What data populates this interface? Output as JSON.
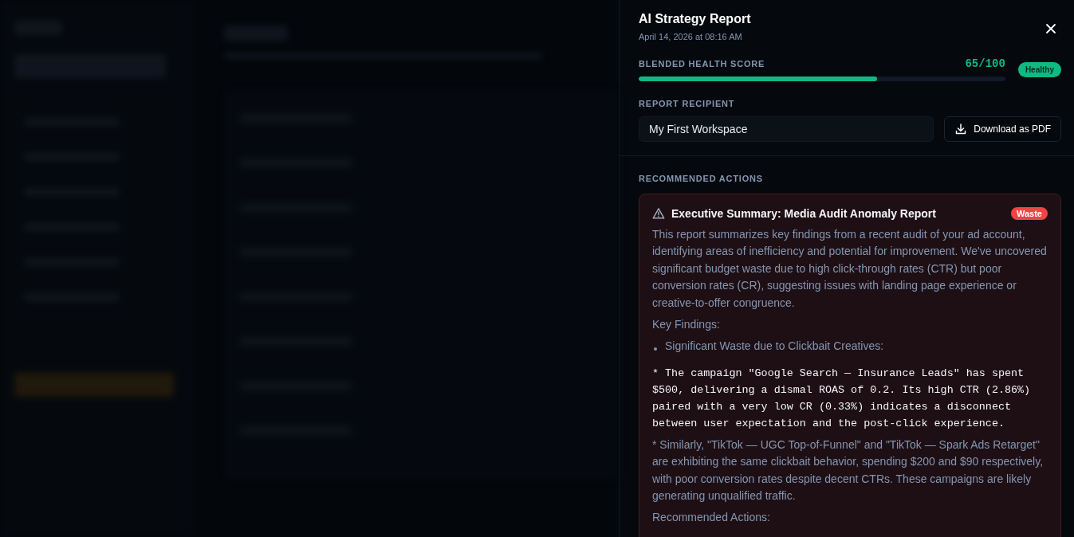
{
  "drawer": {
    "title": "AI Strategy Report",
    "date": "April 14, 2026 at 08:16 AM",
    "health": {
      "label": "BLENDED HEALTH SCORE",
      "score": "65/100",
      "level": 0.65,
      "status": "Healthy"
    },
    "recipient": {
      "label": "REPORT RECIPIENT",
      "value": "My First Workspace"
    },
    "download_button": "Download as PDF",
    "actions": {
      "label": "RECOMMENDED ACTIONS",
      "items": [
        {
          "title": "Executive Summary: Media Audit Anomaly Report",
          "tag": "Waste",
          "color": "#ef4444",
          "blocks": [
            {
              "kind": "paragraph",
              "text": "This report summarizes key findings from a recent audit of your ad account, identifying areas of inefficiency and potential for improvement. We've uncovered significant budget waste due to high click-through rates (CTR) but poor conversion rates (CR), suggesting issues with landing page experience or creative-to-offer congruence."
            },
            {
              "kind": "paragraph",
              "text": "Key Findings:"
            },
            {
              "kind": "bullet",
              "text": "Significant Waste due to Clickbait Creatives:"
            },
            {
              "kind": "code",
              "text": "* The campaign \"Google Search — Insurance Leads\" has spent $500, delivering a dismal ROAS of 0.2. Its high CTR (2.86%) paired with a very low CR (0.33%) indicates a disconnect between user expectation and the post-click experience."
            },
            {
              "kind": "paragraph",
              "text": "* Similarly, \"TikTok — UGC Top-of-Funnel\" and \"TikTok — Spark Ads Retarget\" are exhibiting the same clickbait behavior, spending $200 and $90 respectively, with poor conversion rates despite decent CTRs. These campaigns are likely generating unqualified traffic."
            },
            {
              "kind": "paragraph",
              "text": "Recommended Actions:"
            }
          ]
        }
      ]
    }
  }
}
